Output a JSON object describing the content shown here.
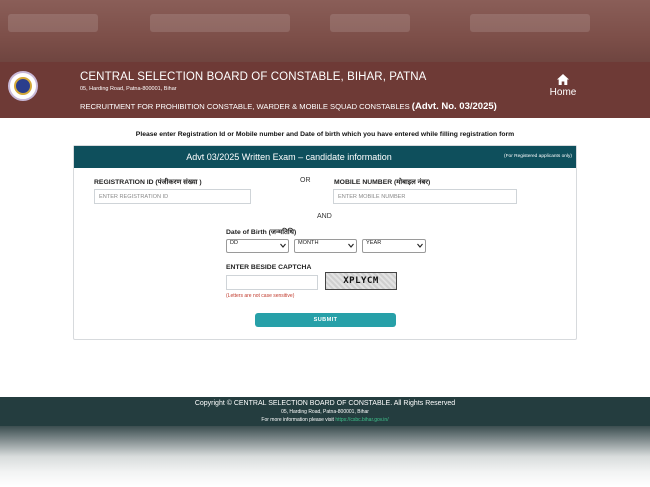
{
  "header": {
    "org_title": "CENTRAL SELECTION BOARD OF CONSTABLE, BIHAR, PATNA",
    "address": "05, Harding Road, Patna-800001, Bihar",
    "recruitment_text": "RECRUITMENT FOR PROHIBITION CONSTABLE, WARDER & MOBILE SQUAD CONSTABLES",
    "advt_no": "(Advt. No. 03/2025)",
    "home_label": "Home"
  },
  "instruction": "Please enter Registration Id or Mobile number and Date of birth which you have entered while filling registration form",
  "card": {
    "title": "Advt 03/2025 Written Exam – candidate information",
    "note": "(For Registered applicants only)",
    "registration_label": "REGISTRATION ID (पंजीकरण संख्या )",
    "registration_placeholder": "ENTER REGISTRATION ID",
    "or_text": "OR",
    "mobile_label": "MOBILE NUMBER (मोबाइल नंबर)",
    "mobile_placeholder": "ENTER MOBILE NUMBER",
    "and_text": "AND",
    "dob_label": "Date of Birth (जन्मतिथि)",
    "dob_day": "DD",
    "dob_month": "MONTH",
    "dob_year": "YEAR",
    "captcha_label": "ENTER BESIDE CAPTCHA",
    "captcha_value": "XPLYCM",
    "captcha_hint": "(Letters are not case sensitive)",
    "submit_label": "SUBMIT"
  },
  "footer": {
    "copyright": "Copyright © CENTRAL SELECTION BOARD OF CONSTABLE. All Rights Reserved",
    "address": "05, Harding Road, Patna-800001, Bihar",
    "info_prefix": "For more information please visit",
    "info_link": "https://csbc.bihar.gov.in/"
  },
  "colors": {
    "header_bg": "#6e3a36",
    "card_header_bg": "#0e4f5c",
    "submit_bg": "#27a0a8",
    "footer_bg": "#243d3f",
    "hint_text": "#c0392b"
  },
  "icons": {
    "logo": "emblem-icon",
    "home": "home-icon",
    "dropdown": "chevron-down-icon"
  }
}
